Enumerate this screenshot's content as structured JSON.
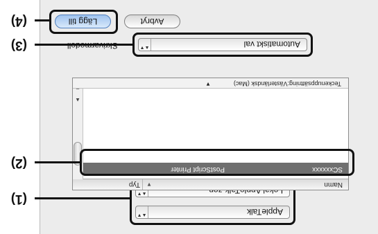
{
  "connection_popup": {
    "label": "AppleTalk",
    "arrows": "▲▼"
  },
  "zone_popup": {
    "label": "Lokal AppleTalk-zon",
    "arrows": "▲▼"
  },
  "printer_list": {
    "header": {
      "name": "Namn",
      "type": "Typ",
      "sort_indicator": "▼"
    },
    "rows": [
      {
        "name": "SCxxxxxx",
        "type": "PostScript Printer"
      }
    ],
    "footer": {
      "encoding": "Teckenuppsättning:Västerländsk (Mac)",
      "arrow": "▼"
    },
    "scroll_up": "▲",
    "scroll_down": "▼"
  },
  "printer_model": {
    "label": "Skrivarmodell",
    "value": "Automatiskt val",
    "arrows": "▲▼"
  },
  "buttons": {
    "cancel": "Avbryt",
    "add": "Lägg till"
  },
  "markers": {
    "m1": "(1)",
    "m2": "(2)",
    "m3": "(3)",
    "m4": "(4)"
  }
}
